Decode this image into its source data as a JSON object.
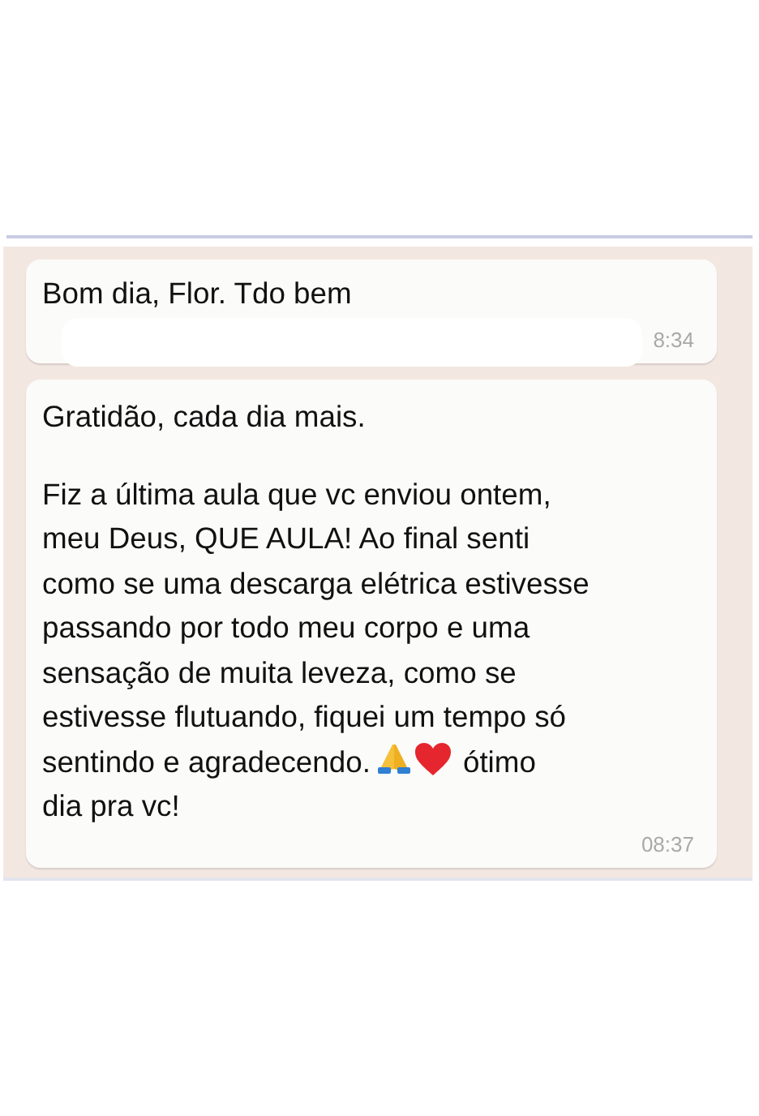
{
  "messages": [
    {
      "kind": "redacted",
      "paragraphs": [
        [
          [
            {
              "kind": "text",
              "text": "Bom dia, Flor. Tdo bem"
            }
          ]
        ]
      ],
      "time": "8:34"
    },
    {
      "kind": "plain",
      "paragraphs": [
        [
          [
            {
              "kind": "text",
              "text": "Gratidão, cada dia mais."
            }
          ]
        ],
        [
          [
            {
              "kind": "text",
              "text": "Fiz a última aula que vc enviou ontem,"
            }
          ],
          [
            {
              "kind": "text",
              "text": "meu Deus, QUE AULA! Ao final senti"
            }
          ],
          [
            {
              "kind": "text",
              "text": "como se uma descarga elétrica estivesse"
            }
          ],
          [
            {
              "kind": "text",
              "text": "passando por todo meu corpo e uma"
            }
          ],
          [
            {
              "kind": "text",
              "text": "sensação de muita leveza, como se"
            }
          ],
          [
            {
              "kind": "text",
              "text": "estivesse flutuando, fiquei um tempo só"
            }
          ],
          [
            {
              "kind": "text",
              "text": "sentindo e agradecendo."
            },
            {
              "kind": "hands"
            },
            {
              "kind": "heart"
            },
            {
              "kind": "text",
              "text": "ótimo"
            }
          ],
          [
            {
              "kind": "text",
              "text": "dia pra vc!"
            }
          ]
        ]
      ],
      "time": "08:37"
    }
  ]
}
